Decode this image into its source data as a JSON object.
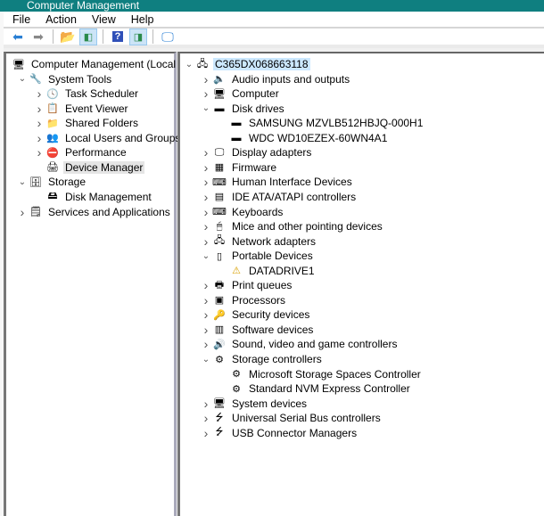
{
  "window": {
    "title": "Computer Management"
  },
  "menu": [
    "File",
    "Action",
    "View",
    "Help"
  ],
  "left_tree": [
    {
      "label": "Computer Management (Local",
      "level": 0,
      "chev": "",
      "icon": "computer-management-icon",
      "sym": "🖥"
    },
    {
      "label": "System Tools",
      "level": 1,
      "chev": "v",
      "icon": "tools-icon",
      "sym": "🔧"
    },
    {
      "label": "Task Scheduler",
      "level": 2,
      "chev": ">",
      "icon": "clock-icon",
      "sym": "🕓"
    },
    {
      "label": "Event Viewer",
      "level": 2,
      "chev": ">",
      "icon": "event-viewer-icon",
      "sym": "📋"
    },
    {
      "label": "Shared Folders",
      "level": 2,
      "chev": ">",
      "icon": "shared-folder-icon",
      "sym": "📁"
    },
    {
      "label": "Local Users and Groups",
      "level": 2,
      "chev": ">",
      "icon": "users-icon",
      "sym": "👥"
    },
    {
      "label": "Performance",
      "level": 2,
      "chev": ">",
      "icon": "performance-icon",
      "sym": "⛔"
    },
    {
      "label": "Device Manager",
      "level": 2,
      "chev": "",
      "icon": "device-manager-icon",
      "sym": "🖨",
      "selected": true
    },
    {
      "label": "Storage",
      "level": 1,
      "chev": "v",
      "icon": "storage-icon",
      "sym": "🗄"
    },
    {
      "label": "Disk Management",
      "level": 2,
      "chev": "",
      "icon": "disk-management-icon",
      "sym": "🖴"
    },
    {
      "label": "Services and Applications",
      "level": 1,
      "chev": ">",
      "icon": "services-icon",
      "sym": "🗒"
    }
  ],
  "right_tree": [
    {
      "label": "C365DX068663118",
      "level": 0,
      "chev": "v",
      "icon": "computer-icon",
      "sym": "🖧",
      "selected": true
    },
    {
      "label": "Audio inputs and outputs",
      "level": 1,
      "chev": ">",
      "icon": "speaker-icon",
      "sym": "🔈"
    },
    {
      "label": "Computer",
      "level": 1,
      "chev": ">",
      "icon": "monitor-icon",
      "sym": "🖥"
    },
    {
      "label": "Disk drives",
      "level": 1,
      "chev": "v",
      "icon": "disk-icon",
      "sym": "▬"
    },
    {
      "label": "SAMSUNG MZVLB512HBJQ-000H1",
      "level": 2,
      "chev": "",
      "icon": "disk-icon",
      "sym": "▬"
    },
    {
      "label": "WDC WD10EZEX-60WN4A1",
      "level": 2,
      "chev": "",
      "icon": "disk-icon",
      "sym": "▬"
    },
    {
      "label": "Display adapters",
      "level": 1,
      "chev": ">",
      "icon": "display-adapter-icon",
      "sym": "🖵"
    },
    {
      "label": "Firmware",
      "level": 1,
      "chev": ">",
      "icon": "firmware-icon",
      "sym": "▦"
    },
    {
      "label": "Human Interface Devices",
      "level": 1,
      "chev": ">",
      "icon": "hid-icon",
      "sym": "⌨"
    },
    {
      "label": "IDE ATA/ATAPI controllers",
      "level": 1,
      "chev": ">",
      "icon": "ide-controller-icon",
      "sym": "▤"
    },
    {
      "label": "Keyboards",
      "level": 1,
      "chev": ">",
      "icon": "keyboard-icon",
      "sym": "⌨"
    },
    {
      "label": "Mice and other pointing devices",
      "level": 1,
      "chev": ">",
      "icon": "mouse-icon",
      "sym": "🖱"
    },
    {
      "label": "Network adapters",
      "level": 1,
      "chev": ">",
      "icon": "network-icon",
      "sym": "🖧"
    },
    {
      "label": "Portable Devices",
      "level": 1,
      "chev": "v",
      "icon": "portable-device-icon",
      "sym": "▯"
    },
    {
      "label": "DATADRIVE1",
      "level": 2,
      "chev": "",
      "icon": "warning-icon",
      "sym": "⚠"
    },
    {
      "label": "Print queues",
      "level": 1,
      "chev": ">",
      "icon": "printer-icon",
      "sym": "🖶"
    },
    {
      "label": "Processors",
      "level": 1,
      "chev": ">",
      "icon": "processor-icon",
      "sym": "▣"
    },
    {
      "label": "Security devices",
      "level": 1,
      "chev": ">",
      "icon": "security-icon",
      "sym": "🔑"
    },
    {
      "label": "Software devices",
      "level": 1,
      "chev": ">",
      "icon": "software-device-icon",
      "sym": "▥"
    },
    {
      "label": "Sound, video and game controllers",
      "level": 1,
      "chev": ">",
      "icon": "sound-icon",
      "sym": "🔊"
    },
    {
      "label": "Storage controllers",
      "level": 1,
      "chev": "v",
      "icon": "storage-controller-icon",
      "sym": "⚙"
    },
    {
      "label": "Microsoft Storage Spaces Controller",
      "level": 2,
      "chev": "",
      "icon": "storage-controller-icon",
      "sym": "⚙"
    },
    {
      "label": "Standard NVM Express Controller",
      "level": 2,
      "chev": "",
      "icon": "storage-controller-icon",
      "sym": "⚙"
    },
    {
      "label": "System devices",
      "level": 1,
      "chev": ">",
      "icon": "system-devices-icon",
      "sym": "🖥"
    },
    {
      "label": "Universal Serial Bus controllers",
      "level": 1,
      "chev": ">",
      "icon": "usb-icon",
      "sym": "⭍"
    },
    {
      "label": "USB Connector Managers",
      "level": 1,
      "chev": ">",
      "icon": "usb-icon",
      "sym": "⭍"
    }
  ]
}
